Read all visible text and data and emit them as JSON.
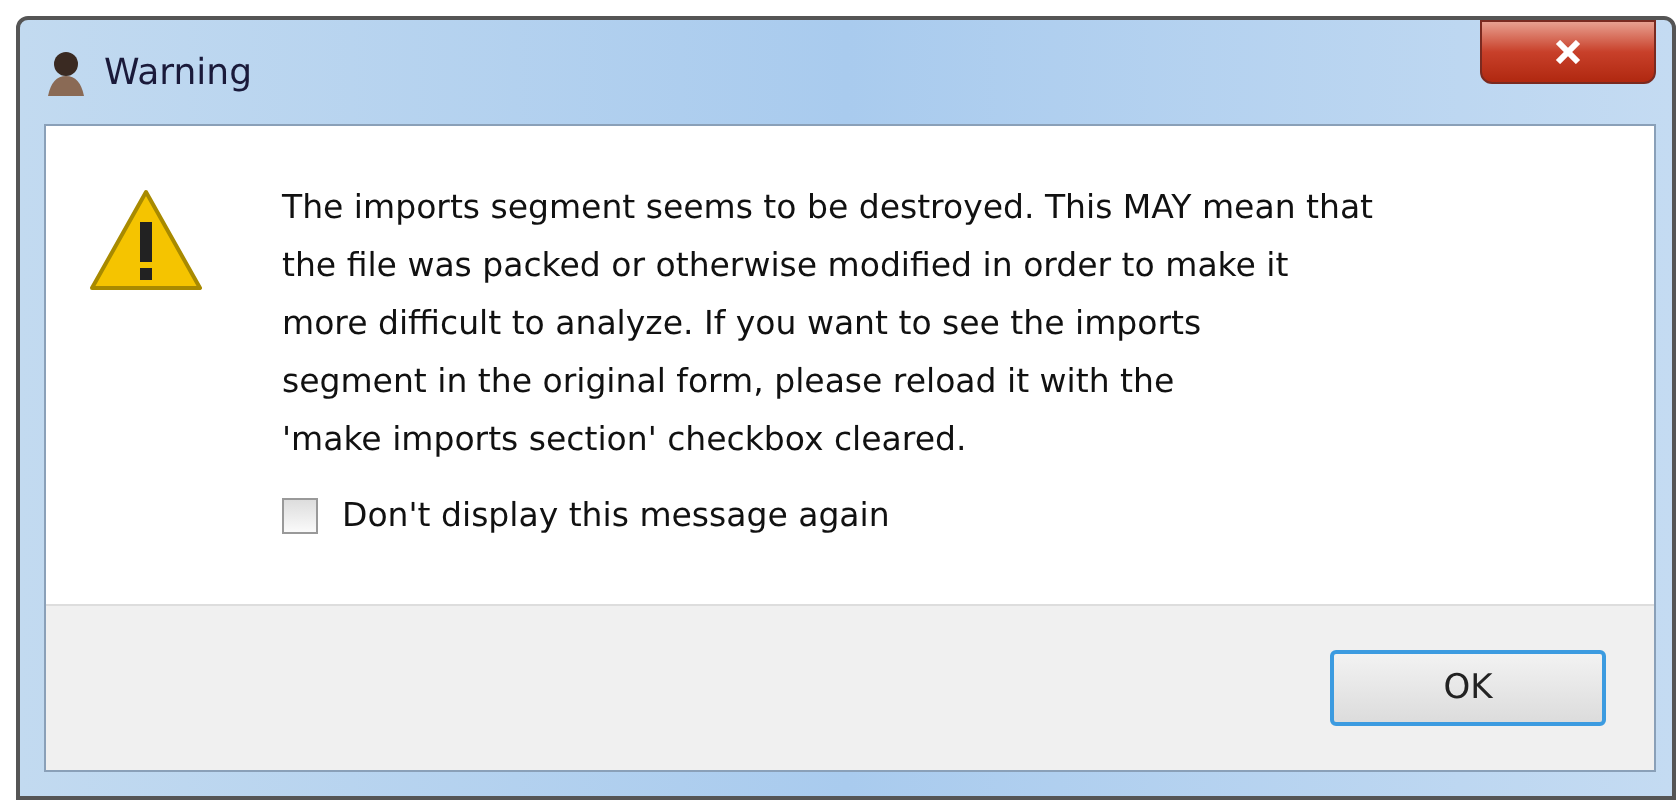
{
  "window": {
    "title": "Warning"
  },
  "message": "The imports segment seems to be destroyed. This MAY mean that\nthe file was packed or otherwise modified in order to make it\nmore difficult to analyze. If you want to see the imports\nsegment in the original form, please reload it with the\n'make imports section' checkbox cleared.",
  "checkbox": {
    "label": "Don't display this message again",
    "checked": false
  },
  "buttons": [
    {
      "label": "OK",
      "selected": true
    }
  ]
}
